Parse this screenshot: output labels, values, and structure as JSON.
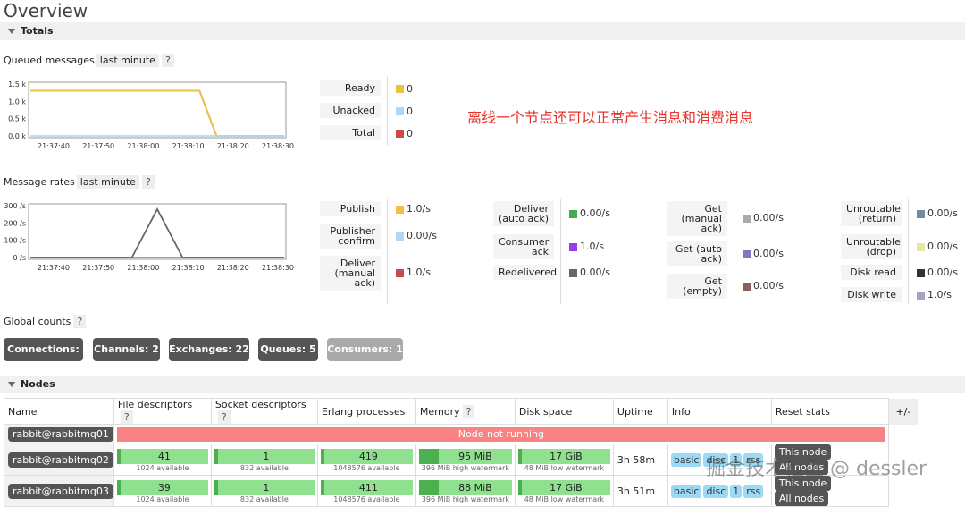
{
  "page": {
    "title": "Overview"
  },
  "totals": {
    "section_label": "Totals"
  },
  "queued": {
    "label": "Queued messages",
    "range": "last minute",
    "help": "?",
    "legend": [
      {
        "label": "Ready",
        "value": "0",
        "color": "#edc240"
      },
      {
        "label": "Unacked",
        "value": "0",
        "color": "#afd8f8"
      },
      {
        "label": "Total",
        "value": "0",
        "color": "#cb4b4b"
      }
    ]
  },
  "annotation": "离线一个节点还可以正常产生消息和消费消息",
  "chart_data": [
    {
      "type": "line",
      "x": [
        "21:37:40",
        "21:37:50",
        "21:38:00",
        "21:38:10",
        "21:38:20",
        "21:38:30"
      ],
      "yticks": [
        "1.5 k",
        "1.0 k",
        "0.5 k",
        "0.0 k"
      ],
      "ylim": [
        0,
        1600
      ],
      "series": [
        {
          "name": "Total",
          "color": "#cb4b4b",
          "points": [
            [
              0,
              1390
            ],
            [
              40,
              1390
            ],
            [
              44,
              0
            ],
            [
              60,
              0
            ]
          ]
        },
        {
          "name": "Ready",
          "color": "#edc240",
          "points": [
            [
              0,
              1390
            ],
            [
              40,
              1390
            ],
            [
              44,
              0
            ],
            [
              60,
              0
            ]
          ]
        },
        {
          "name": "Unacked",
          "color": "#afd8f8",
          "points": [
            [
              0,
              0
            ],
            [
              60,
              0
            ]
          ]
        }
      ]
    },
    {
      "type": "line",
      "x": [
        "21:37:40",
        "21:37:50",
        "21:38:00",
        "21:38:10",
        "21:38:20",
        "21:38:30"
      ],
      "yticks": [
        "300 /s",
        "200 /s",
        "100 /s",
        "0 /s"
      ],
      "ylim": [
        0,
        300
      ],
      "series": [
        {
          "name": "Publish",
          "color": "#edc240",
          "points": [
            [
              0,
              0
            ],
            [
              60,
              0
            ]
          ]
        },
        {
          "name": "Deliver (manual ack)",
          "color": "#cb4b4b",
          "points": [
            [
              0,
              0
            ],
            [
              60,
              0
            ]
          ]
        },
        {
          "name": "Consumer ack",
          "color": "#9440ed",
          "points": [
            [
              0,
              0
            ],
            [
              60,
              0
            ]
          ]
        },
        {
          "name": "Disk write",
          "color": "#aaa0bb",
          "points": [
            [
              0,
              0
            ],
            [
              60,
              0
            ]
          ]
        },
        {
          "name": "Redelivered",
          "color": "#666666",
          "points": [
            [
              0,
              0
            ],
            [
              24,
              0
            ],
            [
              30,
              280
            ],
            [
              36,
              0
            ],
            [
              60,
              0
            ]
          ]
        }
      ]
    }
  ],
  "rates": {
    "label": "Message rates",
    "range": "last minute",
    "help": "?",
    "col1": [
      {
        "label": "Publish",
        "value": "1.0/s",
        "color": "#edc240"
      },
      {
        "label": "Publisher\nconfirm",
        "value": "0.00/s",
        "color": "#afd8f8"
      },
      {
        "label": "Deliver\n(manual\nack)",
        "value": "1.0/s",
        "color": "#cb4b4b"
      }
    ],
    "col2": [
      {
        "label": "Deliver\n(auto ack)",
        "value": "0.00/s",
        "color": "#4da74d"
      },
      {
        "label": "Consumer\nack",
        "value": "1.0/s",
        "color": "#9440ed"
      },
      {
        "label": "Redelivered",
        "value": "0.00/s",
        "color": "#666666"
      }
    ],
    "col3": [
      {
        "label": "Get\n(manual\nack)",
        "value": "0.00/s",
        "color": "#aaaaaa"
      },
      {
        "label": "Get (auto\nack)",
        "value": "0.00/s",
        "color": "#7c79c3"
      },
      {
        "label": "Get\n(empty)",
        "value": "0.00/s",
        "color": "#8d6060"
      }
    ],
    "col4": [
      {
        "label": "Unroutable\n(return)",
        "value": "0.00/s",
        "color": "#738c9c"
      },
      {
        "label": "Unroutable\n(drop)",
        "value": "0.00/s",
        "color": "#e6e6a0"
      },
      {
        "label": "Disk read",
        "value": "0.00/s",
        "color": "#333333"
      },
      {
        "label": "Disk write",
        "value": "1.0/s",
        "color": "#aaa0bb"
      }
    ]
  },
  "global_counts": {
    "label": "Global counts",
    "help": "?",
    "connections": "Connections: 2",
    "channels": "Channels: 2",
    "exchanges": "Exchanges: 22",
    "queues": "Queues: 5",
    "consumers": "Consumers: 1"
  },
  "nodes": {
    "section_label": "Nodes",
    "headers": {
      "name": "Name",
      "fd": "File descriptors",
      "sd": "Socket descriptors",
      "ep": "Erlang processes",
      "mem": "Memory",
      "disk": "Disk space",
      "uptime": "Uptime",
      "info": "Info",
      "reset": "Reset stats",
      "help": "?",
      "plusminus": "+/-"
    },
    "row1": {
      "name": "rabbit@rabbitmq01",
      "status": "Node not running"
    },
    "row2": {
      "name": "rabbit@rabbitmq02",
      "fd": "41",
      "fd_sub": "1024 available",
      "sd": "1",
      "sd_sub": "832 available",
      "ep": "419",
      "ep_sub": "1048576 available",
      "mem": "95 MiB",
      "mem_sub": "396 MiB high watermark",
      "disk": "17 GiB",
      "disk_sub": "48 MiB low watermark",
      "uptime": "3h 58m",
      "info1": "basic",
      "info2": "disc",
      "info3": "1",
      "info4": "rss",
      "btn1": "This node",
      "btn2": "All nodes"
    },
    "row3": {
      "name": "rabbit@rabbitmq03",
      "fd": "39",
      "fd_sub": "1024 available",
      "sd": "1",
      "sd_sub": "832 available",
      "ep": "411",
      "ep_sub": "1048576 available",
      "mem": "88 MiB",
      "mem_sub": "396 MiB high watermark",
      "disk": "17 GiB",
      "disk_sub": "48 MiB low watermark",
      "uptime": "3h 51m",
      "info1": "basic",
      "info2": "disc",
      "info3": "1",
      "info4": "rss",
      "btn1": "This node",
      "btn2": "All nodes"
    }
  },
  "watermark": "掘金技术社区 @ dessler"
}
